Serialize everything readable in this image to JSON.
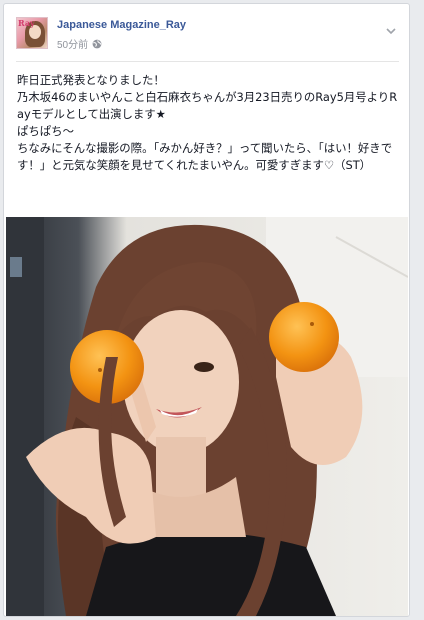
{
  "post": {
    "page_name": "Japanese Magazine_Ray",
    "timestamp": "50分前",
    "privacy_icon": "globe-icon",
    "avatar_logo": "Ray",
    "text_lines": [
      "昨日正式発表となりました！",
      "乃木坂46のまいやんこと白石麻衣ちゃんが3月23日売りのRay5月号よりRayモデルとして出演します★",
      "ぱちぱち～",
      "ちなみにそんな撮影の際。「みかん好き？」って聞いたら、「はい！好きです！」と元気な笑顔を見せてくれたまいやん。可愛すぎます♡（ST）"
    ],
    "photo_icon": "photo-woman-holding-oranges"
  },
  "colors": {
    "link": "#3b5998",
    "meta": "#90949c",
    "text": "#141823",
    "orange": "#f29a12"
  }
}
